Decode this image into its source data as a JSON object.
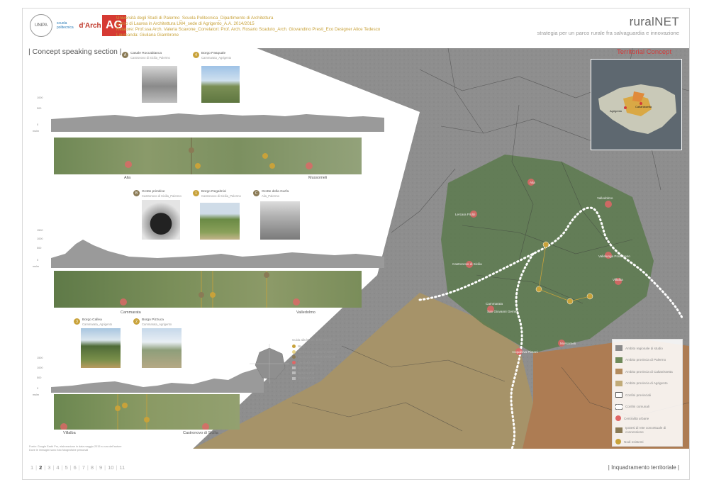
{
  "header": {
    "lines": [
      "Università degli Studi di Palermo_Scuola Politecnica_Dipartimento di Architettura",
      "Corso di Laurea in Architettura LM4_sede di Agrigento_A.A. 2014/2015",
      "Relatore: Prof.ssa Arch. Valeria Scavone_Correlatori: Prof. Arch. Rosario Scaduto_Arch. Giovandino Presti_Eco Designer Alice Tedesco",
      "Laureanda: Giuliana Giambrone"
    ],
    "logos": [
      "UNIPA",
      "scuola politecnica",
      "d'Arch",
      "AG"
    ],
    "title": "ruralNET",
    "subtitle": "strategia per un parco rurale fra salvaguardia e innovazione"
  },
  "section_label": "| Concept speaking section |",
  "territorial_label": "Territorial Concept",
  "colors": {
    "accent_gold": "#c8a23a",
    "accent_red": "#d23a3a",
    "map_gray": "#8d8d8d",
    "map_green": "#5f7a4f",
    "map_tan": "#b19a66",
    "map_orange": "#b47c4f"
  },
  "sections": [
    {
      "id": "A",
      "photos": [
        {
          "num": "A",
          "name": "Casale Roccabianca",
          "sub": "Castronovo di Sicilia_Palermo",
          "color": "#8a7a55"
        },
        {
          "num": "4",
          "name": "Borgo Pasquale",
          "sub": "Cammarata_Agrigento",
          "color": "#c8a23a"
        }
      ],
      "towns": [
        "Alia",
        "Mussomeli"
      ],
      "axis": [
        "mslm",
        "1000",
        "500",
        "0"
      ]
    },
    {
      "id": "B",
      "photos": [
        {
          "num": "B",
          "name": "Grotte primitive",
          "sub": "Castronovo di Sicilia_Palermo",
          "color": "#8a7a55"
        },
        {
          "num": "1",
          "name": "Borgo Regalmici",
          "sub": "Castronovo di Sicilia_Palermo",
          "color": "#c8a23a"
        },
        {
          "num": "C",
          "name": "Grotte della Gurfa",
          "sub": "Alia_Palermo",
          "color": "#8a7a55"
        }
      ],
      "towns": [
        "Cammarata",
        "Valledolmo"
      ],
      "axis": [
        "mslm",
        "1500",
        "1000",
        "500",
        "0"
      ]
    },
    {
      "id": "C",
      "photos": [
        {
          "num": "3",
          "name": "Borgo Callea",
          "sub": "Cammarata_Agrigento",
          "color": "#c8a23a"
        },
        {
          "num": "2",
          "name": "Borgo Pizzuca",
          "sub": "Cammarata_Agrigento",
          "color": "#c8a23a"
        }
      ],
      "towns": [
        "Villalba",
        "Castronovo di Sicilia"
      ],
      "axis": [
        "mslm",
        "1500",
        "1000",
        "500",
        "0"
      ]
    }
  ],
  "mini_legend": {
    "title": "Guida alla lettura delle sezioni",
    "items": [
      {
        "label": "Nodi",
        "color": "#c8a23a",
        "shape": "dot"
      },
      {
        "label": "Nodi non compresi in sezione",
        "color": "#e8d488",
        "shape": "dot"
      },
      {
        "label": "Esempi di attrattori territoriali",
        "color": "#8a7a55",
        "shape": "dot"
      },
      {
        "label": "Centralità urbane",
        "color": "#e06666",
        "shape": "dot"
      },
      {
        "label": "Sezione A-A",
        "color": "#bbbbbb",
        "shape": "sq"
      },
      {
        "label": "Sezione B-B",
        "color": "#bbbbbb",
        "shape": "sq"
      },
      {
        "label": "Sezione C-C",
        "color": "#bbbbbb",
        "shape": "sq"
      }
    ]
  },
  "map_towns": [
    "Alia",
    "Valledolmo",
    "Lercara Friddi",
    "Vallelunga Pratameno",
    "Castronovo di Sicilia",
    "Villalba",
    "Cammarata",
    "San Giovanni Gemini",
    "Acquaviva Platani",
    "Mussomeli"
  ],
  "inset_labels": [
    "Agrigento",
    "Caltanissetta"
  ],
  "legend": [
    {
      "label": "Ambito regionale di studio",
      "color": "#8a8a8a"
    },
    {
      "label": "Ambito provincia di Palermo",
      "color": "#6f8a5a"
    },
    {
      "label": "Ambito provincia di Caltanissetta",
      "color": "#b38b5e"
    },
    {
      "label": "Ambito provincia di Agrigento",
      "color": "#c1ab78"
    },
    {
      "label": "Confini provinciali",
      "color": "#555555"
    },
    {
      "label": "Confini comunali",
      "color": "#777777"
    },
    {
      "label": "Centralità urbane",
      "color": "#e06666"
    },
    {
      "label": "Ipotesi di rete concettuale di connessione",
      "color": "#ffffff"
    },
    {
      "label": "Nodi esistenti",
      "color": "#c8a23a"
    }
  ],
  "source": [
    "Fonte: Google Earth Pro, elaborazione in data maggio 2015 a cura dell'autore",
    "Dove le immagini sono foto fotografiche personali"
  ],
  "nav": {
    "pages": [
      "1",
      "2",
      "3",
      "4",
      "5",
      "6",
      "7",
      "8",
      "9",
      "10",
      "11"
    ],
    "current": "2"
  },
  "footer_title": "| Inquadramento territoriale |"
}
